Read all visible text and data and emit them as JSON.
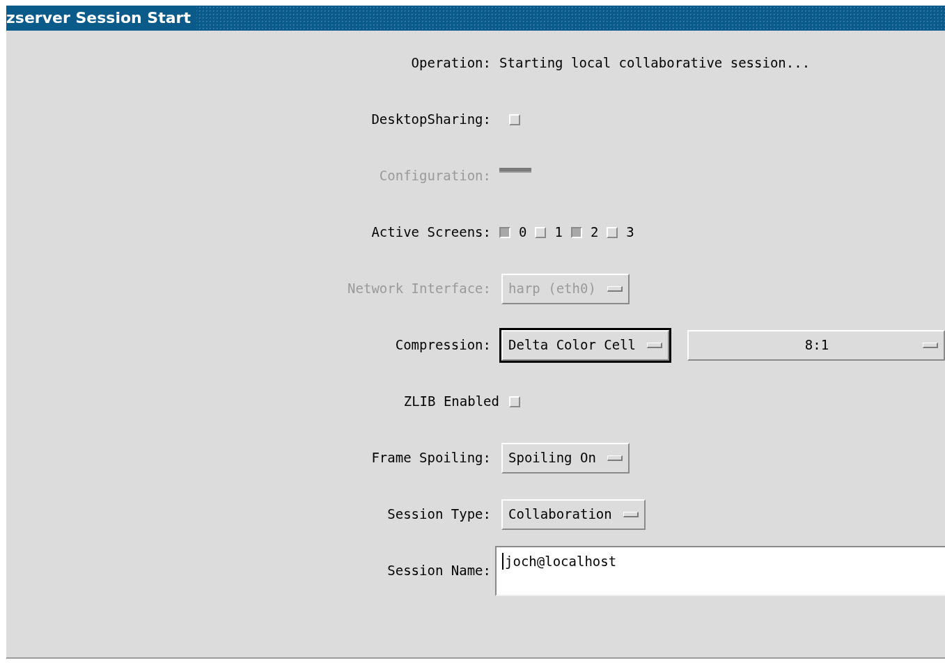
{
  "window": {
    "title": "zserver Session Start"
  },
  "rows": [
    {
      "kind": "text",
      "label": "Operation:",
      "value": "Starting local collaborative session...",
      "disabled": false
    },
    {
      "kind": "checkbox",
      "label": "DesktopSharing:",
      "checked": false,
      "disabled": false
    },
    {
      "kind": "empty_menu",
      "label": "Configuration:",
      "disabled": true
    },
    {
      "kind": "checks",
      "label": "Active Screens:",
      "disabled": false,
      "items": [
        {
          "label": "0",
          "checked": true
        },
        {
          "label": "1",
          "checked": false
        },
        {
          "label": "2",
          "checked": true
        },
        {
          "label": "3",
          "checked": false
        }
      ]
    },
    {
      "kind": "menu",
      "label": "Network Interface:",
      "disabled": true,
      "menus": [
        {
          "value": "harp (eth0)",
          "focused": false
        }
      ]
    },
    {
      "kind": "menu",
      "label": "Compression:",
      "disabled": false,
      "menus": [
        {
          "value": "Delta Color Cell",
          "focused": true
        },
        {
          "value": "8:1",
          "focused": false
        }
      ]
    },
    {
      "kind": "checkbox",
      "label": "ZLIB Enabled",
      "checked": false,
      "disabled": false
    },
    {
      "kind": "menu",
      "label": "Frame Spoiling:",
      "disabled": false,
      "menus": [
        {
          "value": "Spoiling On",
          "focused": false
        }
      ]
    },
    {
      "kind": "menu",
      "label": "Session Type:",
      "disabled": false,
      "menus": [
        {
          "value": "Collaboration",
          "focused": false
        }
      ]
    },
    {
      "kind": "text_field",
      "label": "Session Name:",
      "value": "joch@localhost",
      "disabled": false
    }
  ]
}
